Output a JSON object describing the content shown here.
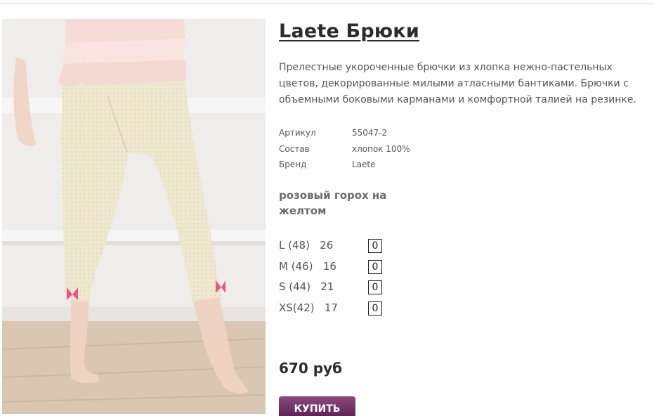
{
  "product": {
    "title": "Laete Брюки",
    "description": "Прелестные укороченные брючки из хлопка нежно-пастельных цветов, декорированные милыми атласными бантиками. Брючки с объемными боковыми карманами и комфортной талией на резинке.",
    "specs": [
      {
        "label": "Артикул",
        "value": "55047-2"
      },
      {
        "label": "Состав",
        "value": "хлопок 100%"
      },
      {
        "label": "Бренд",
        "value": "Laete"
      }
    ],
    "color": "розовый горох на желтом",
    "sizes": [
      {
        "label": "L (48)   26",
        "qty": "0"
      },
      {
        "label": "M (46)   16",
        "qty": "0"
      },
      {
        "label": "S (44)   21",
        "qty": "0"
      },
      {
        "label": "XS(42)   17",
        "qty": "0"
      }
    ],
    "price": "670 руб",
    "buy_label": "КУПИТЬ"
  },
  "photo": {
    "subject": "cropped cream polka-dot pants with pink bows",
    "colors": {
      "wall": "#efecec",
      "floor": "#d9c7b3",
      "pants": "#eee8cf",
      "top": "#f6dcd7",
      "bow": "#e5578a"
    }
  },
  "colors": {
    "title": "#2c2c2c",
    "text": "#555555",
    "button_top": "#8b4a7e",
    "button_bottom": "#5f2456"
  }
}
